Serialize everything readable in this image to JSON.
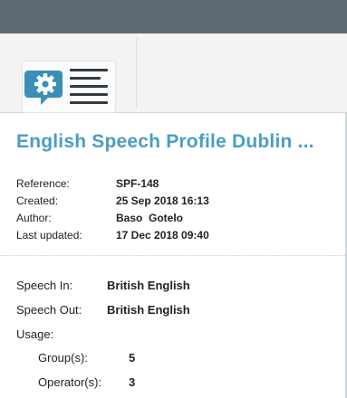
{
  "colors": {
    "top_bar": "#5c6b73",
    "title": "#4a9ec4",
    "icon_bubble": "#3b8fb7",
    "icon_lines": "#2f3a42"
  },
  "logo": {
    "icon": "speech-settings-icon"
  },
  "profile": {
    "title": "English Speech Profile Dublin ...",
    "meta": [
      {
        "label": "Reference:",
        "value": "SPF-148"
      },
      {
        "label": "Created:",
        "value": "25 Sep 2018 16:13"
      },
      {
        "label": "Author:",
        "value": "Baso  Gotelo"
      },
      {
        "label": "Last updated:",
        "value": "17 Dec 2018 09:40"
      }
    ],
    "speech_in": {
      "label": "Speech In:",
      "value": "British English"
    },
    "speech_out": {
      "label": "Speech Out:",
      "value": "British English"
    },
    "usage": {
      "label": "Usage:",
      "groups": {
        "label": "Group(s):",
        "value": "5"
      },
      "operators": {
        "label": "Operator(s):",
        "value": "3"
      }
    }
  }
}
